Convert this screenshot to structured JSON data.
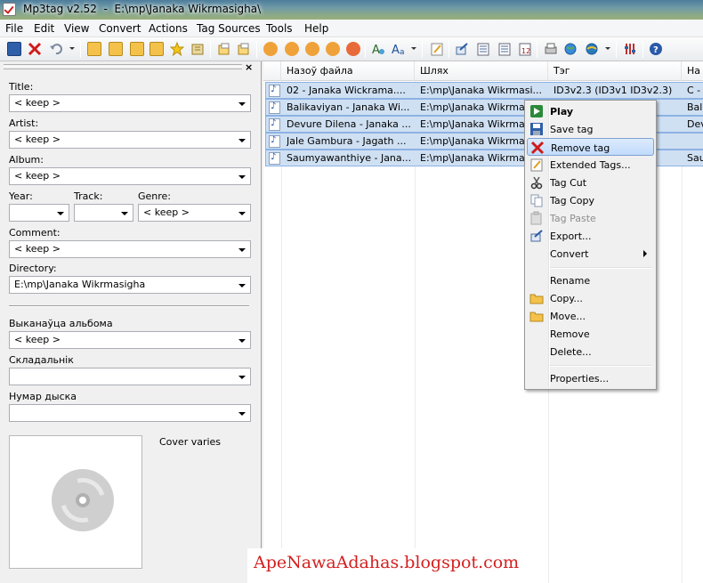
{
  "window": {
    "title": "Mp3tag v2.52  -  E:\\mp\\Janaka Wikrmasigha\\"
  },
  "menu": [
    "File",
    "Edit",
    "View",
    "Convert",
    "Actions",
    "Tag Sources",
    "Tools",
    "Help"
  ],
  "panel": {
    "close_glyph": "×",
    "fields": {
      "title": {
        "label": "Title:",
        "value": "< keep >"
      },
      "artist": {
        "label": "Artist:",
        "value": "< keep >"
      },
      "album": {
        "label": "Album:",
        "value": "< keep >"
      },
      "year": {
        "label": "Year:",
        "value": ""
      },
      "track": {
        "label": "Track:",
        "value": ""
      },
      "genre": {
        "label": "Genre:",
        "value": "< keep >"
      },
      "comment": {
        "label": "Comment:",
        "value": "< keep >"
      },
      "directory": {
        "label": "Directory:",
        "value": "E:\\mp\\Janaka Wikrmasigha"
      },
      "album_artist": {
        "label": "Выканаўца альбома",
        "value": "< keep >"
      },
      "composer": {
        "label": "Складальнік",
        "value": ""
      },
      "disc_number": {
        "label": "Нумар дыска",
        "value": ""
      }
    },
    "cover_text": "Cover varies"
  },
  "list": {
    "columns": [
      "Назоў файла",
      "Шлях",
      "Тэг",
      "На"
    ],
    "rows": [
      {
        "filename": "02 - Janaka Wickrama....",
        "path": "E:\\mp\\Janaka Wikrmasi...",
        "tag": "ID3v2.3 (ID3v1 ID3v2.3)",
        "extra": "C -"
      },
      {
        "filename": "Balikaviyan - Janaka Wi...",
        "path": "E:\\mp\\Janaka Wikrma",
        "tag": "",
        "extra": "Bal"
      },
      {
        "filename": "Devure Dilena - Janaka ...",
        "path": "E:\\mp\\Janaka Wikrma",
        "tag": "",
        "extra": "Dev"
      },
      {
        "filename": "Jale Gambura - Jagath ...",
        "path": "E:\\mp\\Janaka Wikrma",
        "tag": "",
        "extra": ""
      },
      {
        "filename": "Saumyawanthiye - Jana...",
        "path": "E:\\mp\\Janaka Wikrma",
        "tag": "",
        "extra": "Sau"
      }
    ]
  },
  "context_menu": {
    "items": [
      {
        "label": "Play",
        "icon": "play-icon"
      },
      {
        "label": "Save tag",
        "icon": "save-icon"
      },
      {
        "label": "Remove tag",
        "icon": "remove-icon",
        "highlighted": true
      },
      {
        "label": "Extended Tags...",
        "icon": "extended-tags-icon"
      },
      {
        "label": "Tag Cut",
        "icon": "scissors-icon"
      },
      {
        "label": "Tag Copy",
        "icon": "copy-icon"
      },
      {
        "label": "Tag Paste",
        "icon": "paste-icon",
        "disabled": true
      },
      {
        "label": "Export...",
        "icon": "export-icon"
      },
      {
        "label": "Convert",
        "icon": "",
        "submenu": true
      },
      {
        "label": "Rename",
        "icon": ""
      },
      {
        "label": "Copy...",
        "icon": "folder-icon"
      },
      {
        "label": "Move...",
        "icon": "folder-icon"
      },
      {
        "label": "Remove",
        "icon": ""
      },
      {
        "label": "Delete...",
        "icon": ""
      },
      {
        "label": "Properties...",
        "icon": ""
      }
    ]
  },
  "watermark": "ApeNawaAdahas.blogspot.com",
  "colors": {
    "selection": "#cfe0f3",
    "highlight": "#c1dbfc",
    "watermark": "#d42020"
  }
}
